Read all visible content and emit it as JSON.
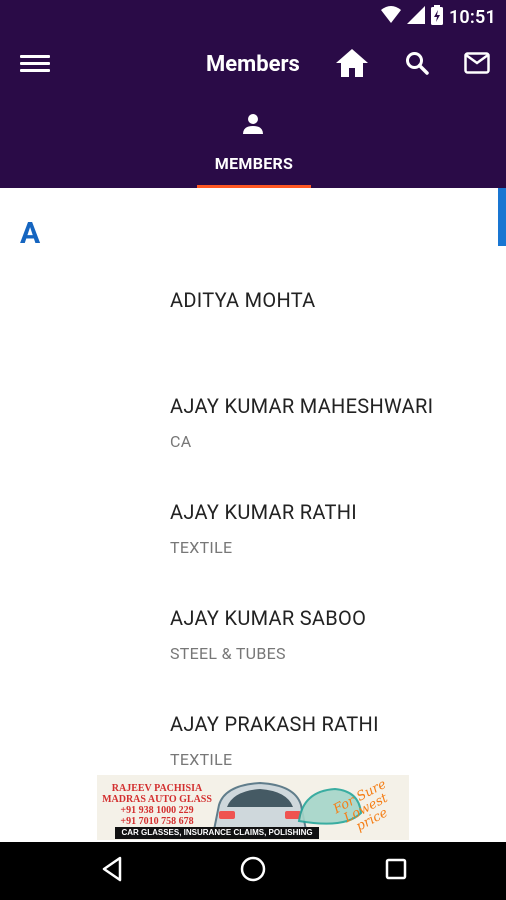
{
  "status_bar": {
    "time": "10:51",
    "icons": [
      "wifi-icon",
      "signal-icon",
      "battery-icon"
    ]
  },
  "app_bar": {
    "title": "Members",
    "actions": [
      "home-icon",
      "search-icon",
      "mail-icon"
    ]
  },
  "tabs": [
    {
      "label": "MEMBERS",
      "icon": "person-icon",
      "selected": true
    }
  ],
  "section": {
    "letter": "A"
  },
  "members": [
    {
      "name": "ADITYA MOHTA",
      "subtitle": ""
    },
    {
      "name": "AJAY KUMAR MAHESHWARI",
      "subtitle": "CA"
    },
    {
      "name": "AJAY KUMAR RATHI",
      "subtitle": "TEXTILE"
    },
    {
      "name": "AJAY KUMAR SABOO",
      "subtitle": "STEEL & TUBES"
    },
    {
      "name": "AJAY PRAKASH RATHI",
      "subtitle": "TEXTILE"
    }
  ],
  "ad": {
    "line1": "RAJEEV PACHISIA",
    "line2": "MADRAS AUTO GLASS",
    "phone1": "+91 938 1000 229",
    "phone2": "+91 7010 758 678",
    "bottom": "CAR GLASSES, INSURANCE CLAIMS, POLISHING",
    "promo": "For Sure Lowest price"
  },
  "colors": {
    "primary": "#2a0b47",
    "accent": "#ff5722",
    "section_letter": "#1565c0"
  }
}
